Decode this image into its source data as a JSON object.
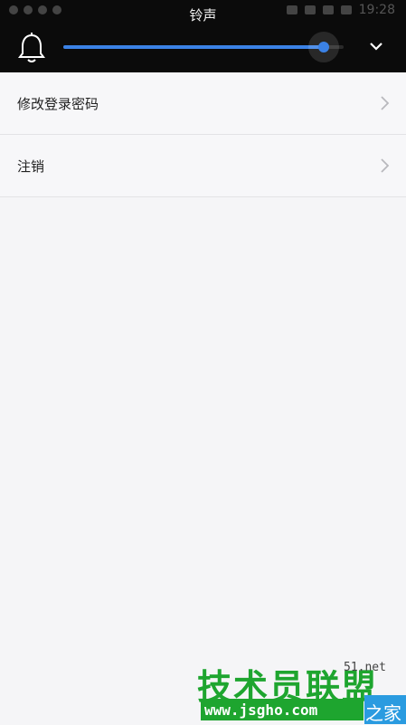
{
  "overlay": {
    "title": "铃声",
    "status_time": "19:28",
    "volume_level": 0.93,
    "accent_color": "#3b82e6",
    "icons": [
      "bell-icon",
      "chevron-down-icon"
    ]
  },
  "settings": {
    "items": [
      {
        "label": "修改登录密码"
      },
      {
        "label": "注销"
      }
    ]
  },
  "watermark": {
    "text": "技术员联盟",
    "domain": "51.net",
    "url": "www.jsgho.com",
    "home": "之家"
  }
}
